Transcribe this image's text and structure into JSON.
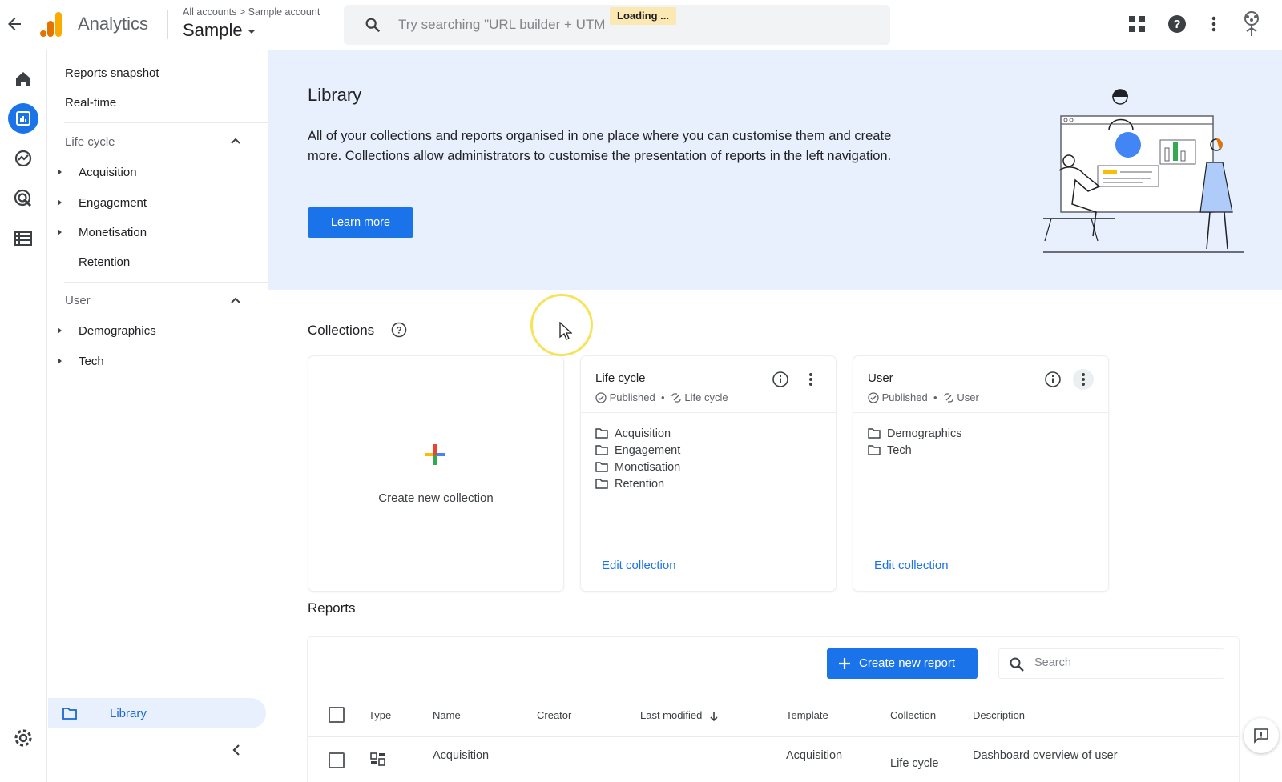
{
  "topbar": {
    "brand": "Analytics",
    "breadcrumb_all": "All accounts",
    "breadcrumb_account": "Sample account",
    "account_name": "Sample",
    "search_placeholder": "Try searching \"URL builder + UTM",
    "loading_label": "Loading ...",
    "icons": [
      "back-arrow-icon",
      "apps-grid-icon",
      "help-icon",
      "more-vert-icon",
      "account-avatar-icon"
    ]
  },
  "rail": {
    "icons": [
      "home-icon",
      "reports-icon",
      "explore-icon",
      "advertising-icon",
      "configure-icon",
      "settings-icon"
    ]
  },
  "leftnav": {
    "top_items": [
      "Reports snapshot",
      "Real-time"
    ],
    "sections": [
      {
        "title": "Life cycle",
        "items": [
          "Acquisition",
          "Engagement",
          "Monetisation",
          "Retention"
        ]
      },
      {
        "title": "User",
        "items": [
          "Demographics",
          "Tech"
        ]
      }
    ],
    "library_label": "Library"
  },
  "hero": {
    "title": "Library",
    "text": "All of your collections and reports organised in one place where you can customise them and create more. Collections allow administrators to customise the presentation of reports in the left navigation.",
    "learn_more": "Learn more"
  },
  "collections": {
    "title": "Collections",
    "create_label": "Create new collection",
    "cards": [
      {
        "title": "Life cycle",
        "status": "Published",
        "type": "Life cycle",
        "items": [
          "Acquisition",
          "Engagement",
          "Monetisation",
          "Retention"
        ],
        "edit": "Edit collection"
      },
      {
        "title": "User",
        "status": "Published",
        "type": "User",
        "items": [
          "Demographics",
          "Tech"
        ],
        "edit": "Edit collection"
      }
    ]
  },
  "reports": {
    "title": "Reports",
    "create_label": "Create new report",
    "search_placeholder": "Search",
    "columns": [
      "Type",
      "Name",
      "Creator",
      "Last modified",
      "Template",
      "Collection",
      "Description"
    ],
    "rows": [
      {
        "name": "Acquisition",
        "template": "Acquisition",
        "collection": "Life cycle",
        "description": "Dashboard overview of user"
      }
    ]
  },
  "colors": {
    "accent": "#1a73e8",
    "hero_bg": "#e8f0fe",
    "nav_active_bg": "#e8f0fe"
  }
}
